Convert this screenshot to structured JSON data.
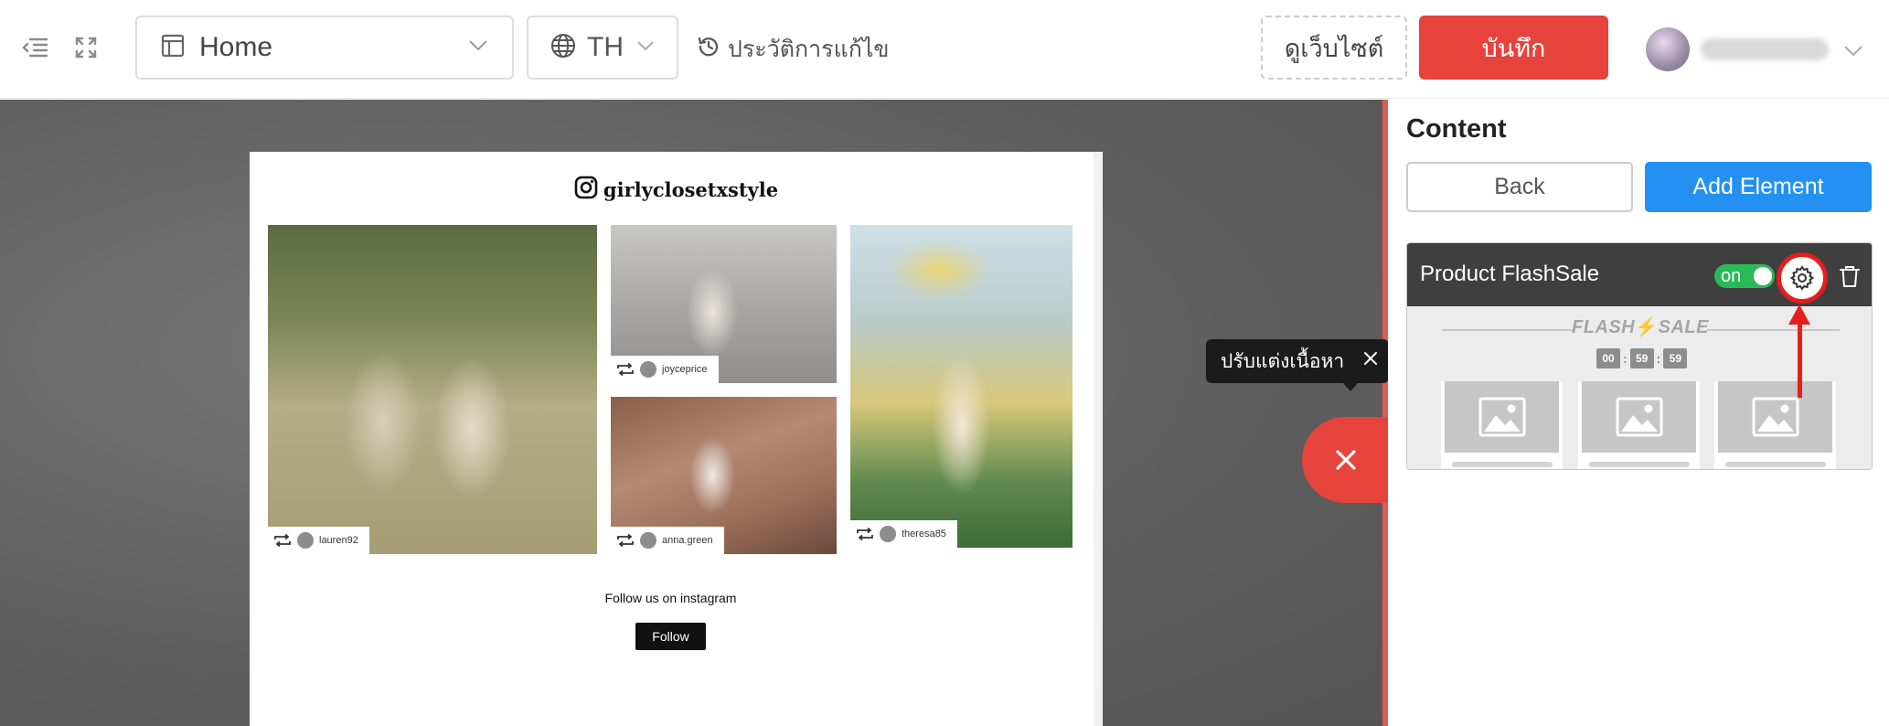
{
  "topbar": {
    "page_select": "Home",
    "language": "TH",
    "history_label": "ประวัติการแก้ไข",
    "view_site_label": "ดูเว็บไซต์",
    "save_label": "บันทึก"
  },
  "preview": {
    "ig_handle": "girlyclosetxstyle",
    "photos": [
      {
        "user": "lauren92"
      },
      {
        "user": "joyceprice"
      },
      {
        "user": "anna.green"
      },
      {
        "user": "theresa85"
      }
    ],
    "follow_text": "Follow us on instagram",
    "follow_button": "Follow"
  },
  "tooltip": {
    "text": "ปรับแต่งเนื้อหา"
  },
  "panel": {
    "title": "Content",
    "back_label": "Back",
    "add_label": "Add Element",
    "element": {
      "title": "Product FlashSale",
      "toggle_label": "on",
      "preview": {
        "flash_word": "FLASH",
        "sale_word": "SALE",
        "timer": [
          "00",
          "59",
          "59"
        ]
      }
    }
  },
  "colors": {
    "save_red": "#e5433b",
    "add_blue": "#2491f2",
    "toggle_green": "#2ab956",
    "highlight_red": "#e41e1e"
  }
}
